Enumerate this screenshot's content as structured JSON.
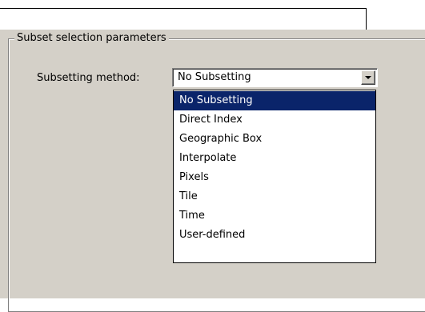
{
  "group": {
    "title": "Subset selection parameters"
  },
  "subsetting": {
    "label": "Subsetting method:",
    "value": "No Subsetting",
    "options": [
      "No Subsetting",
      "Direct Index",
      "Geographic Box",
      "Interpolate",
      "Pixels",
      "Tile",
      "Time",
      "User-defined"
    ],
    "selected_index": 0
  },
  "colors": {
    "panel": "#d4d0c8",
    "highlight": "#0a246a",
    "highlight_text": "#ffffff",
    "callout": "#000000"
  },
  "icons": {
    "dropdown": "chevron-down-icon",
    "callout": "callout-arrow-icon"
  }
}
